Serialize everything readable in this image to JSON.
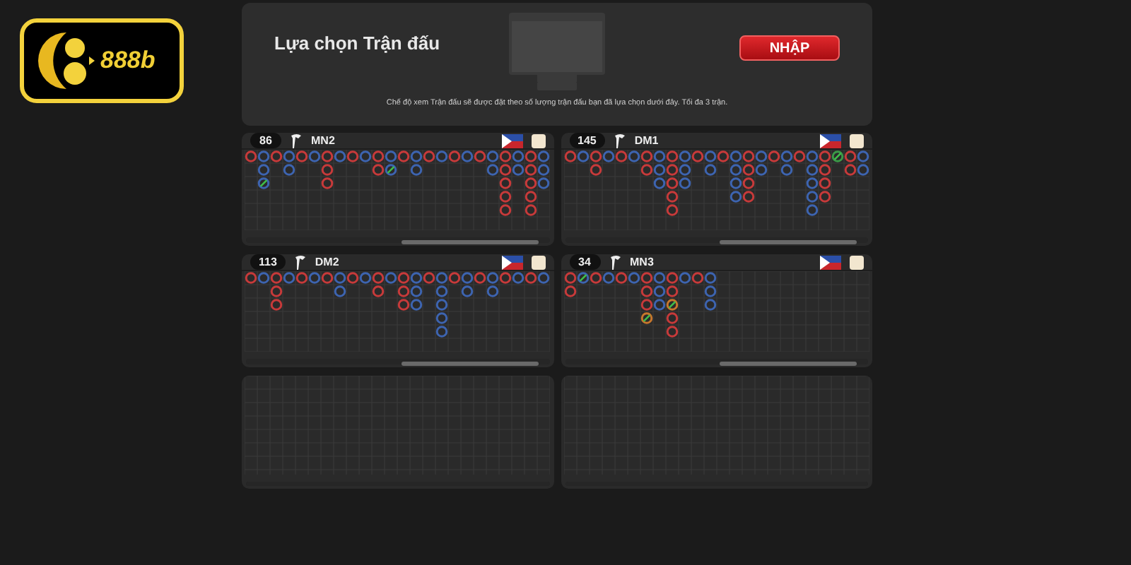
{
  "logo": {
    "text": "888b"
  },
  "header": {
    "title": "Lựa chọn Trận đấu",
    "button": "NHẬP",
    "note": "Chế độ xem Trận đấu sẽ được đặt theo số lượng trận đấu bạn đã lựa chọn dưới đây. Tối đa 3 trận."
  },
  "tables": [
    {
      "kind": "road",
      "count": "86",
      "name": "MN2",
      "selected": false,
      "columns": [
        [
          {
            "color": "#c73a3a",
            "tie": false
          }
        ],
        [
          {
            "color": "#3d64b0",
            "tie": false
          },
          {
            "color": "#3d64b0",
            "tie": false
          },
          {
            "color": "#3d64b0",
            "tie": true
          }
        ],
        [
          {
            "color": "#c73a3a",
            "tie": false
          }
        ],
        [
          {
            "color": "#3d64b0",
            "tie": false
          },
          {
            "color": "#3d64b0",
            "tie": false
          }
        ],
        [
          {
            "color": "#c73a3a",
            "tie": false
          }
        ],
        [
          {
            "color": "#3d64b0",
            "tie": false
          }
        ],
        [
          {
            "color": "#c73a3a",
            "tie": false
          },
          {
            "color": "#c73a3a",
            "tie": false
          },
          {
            "color": "#c73a3a",
            "tie": false
          }
        ],
        [
          {
            "color": "#3d64b0",
            "tie": false
          }
        ],
        [
          {
            "color": "#c73a3a",
            "tie": false
          }
        ],
        [
          {
            "color": "#3d64b0",
            "tie": false
          }
        ],
        [
          {
            "color": "#c73a3a",
            "tie": false
          },
          {
            "color": "#c73a3a",
            "tie": false
          }
        ],
        [
          {
            "color": "#3d64b0",
            "tie": false
          },
          {
            "color": "#3d64b0",
            "tie": true
          }
        ],
        [
          {
            "color": "#c73a3a",
            "tie": false
          }
        ],
        [
          {
            "color": "#3d64b0",
            "tie": false
          },
          {
            "color": "#3d64b0",
            "tie": false
          }
        ],
        [
          {
            "color": "#c73a3a",
            "tie": false
          }
        ],
        [
          {
            "color": "#3d64b0",
            "tie": false
          }
        ],
        [
          {
            "color": "#c73a3a",
            "tie": false
          }
        ],
        [
          {
            "color": "#3d64b0",
            "tie": false
          }
        ],
        [
          {
            "color": "#c73a3a",
            "tie": false
          }
        ],
        [
          {
            "color": "#3d64b0",
            "tie": false
          },
          {
            "color": "#3d64b0",
            "tie": false
          }
        ],
        [
          {
            "color": "#c73a3a",
            "tie": false
          },
          {
            "color": "#c73a3a",
            "tie": false
          },
          {
            "color": "#c73a3a",
            "tie": false
          },
          {
            "color": "#c73a3a",
            "tie": false
          },
          {
            "color": "#c73a3a",
            "tie": false
          }
        ],
        [
          {
            "color": "#3d64b0",
            "tie": false
          },
          {
            "color": "#3d64b0",
            "tie": false
          }
        ],
        [
          {
            "color": "#c73a3a",
            "tie": false
          },
          {
            "color": "#c73a3a",
            "tie": false
          },
          {
            "color": "#c73a3a",
            "tie": false
          },
          {
            "color": "#c73a3a",
            "tie": false
          },
          {
            "color": "#c73a3a",
            "tie": false
          }
        ],
        [
          {
            "color": "#3d64b0",
            "tie": false
          },
          {
            "color": "#3d64b0",
            "tie": false
          },
          {
            "color": "#3d64b0",
            "tie": false
          }
        ]
      ]
    },
    {
      "kind": "road",
      "count": "145",
      "name": "DM1",
      "selected": false,
      "columns": [
        [
          {
            "color": "#c73a3a",
            "tie": false
          }
        ],
        [
          {
            "color": "#3d64b0",
            "tie": false
          }
        ],
        [
          {
            "color": "#c73a3a",
            "tie": false
          },
          {
            "color": "#c73a3a",
            "tie": false
          }
        ],
        [
          {
            "color": "#3d64b0",
            "tie": false
          }
        ],
        [
          {
            "color": "#c73a3a",
            "tie": false
          }
        ],
        [
          {
            "color": "#3d64b0",
            "tie": false
          }
        ],
        [
          {
            "color": "#c73a3a",
            "tie": false
          },
          {
            "color": "#c73a3a",
            "tie": false
          }
        ],
        [
          {
            "color": "#3d64b0",
            "tie": false
          },
          {
            "color": "#3d64b0",
            "tie": false
          },
          {
            "color": "#3d64b0",
            "tie": false
          }
        ],
        [
          {
            "color": "#c73a3a",
            "tie": false
          },
          {
            "color": "#c73a3a",
            "tie": false
          },
          {
            "color": "#c73a3a",
            "tie": false
          },
          {
            "color": "#c73a3a",
            "tie": false
          },
          {
            "color": "#c73a3a",
            "tie": false
          }
        ],
        [
          {
            "color": "#3d64b0",
            "tie": false
          },
          {
            "color": "#3d64b0",
            "tie": false
          },
          {
            "color": "#3d64b0",
            "tie": false
          }
        ],
        [
          {
            "color": "#c73a3a",
            "tie": false
          }
        ],
        [
          {
            "color": "#3d64b0",
            "tie": false
          },
          {
            "color": "#3d64b0",
            "tie": false
          }
        ],
        [
          {
            "color": "#c73a3a",
            "tie": false
          }
        ],
        [
          {
            "color": "#3d64b0",
            "tie": false
          },
          {
            "color": "#3d64b0",
            "tie": false
          },
          {
            "color": "#3d64b0",
            "tie": false
          },
          {
            "color": "#3d64b0",
            "tie": false
          }
        ],
        [
          {
            "color": "#c73a3a",
            "tie": false
          },
          {
            "color": "#c73a3a",
            "tie": false
          },
          {
            "color": "#c73a3a",
            "tie": false
          },
          {
            "color": "#c73a3a",
            "tie": false
          }
        ],
        [
          {
            "color": "#3d64b0",
            "tie": false
          },
          {
            "color": "#3d64b0",
            "tie": false
          }
        ],
        [
          {
            "color": "#c73a3a",
            "tie": false
          }
        ],
        [
          {
            "color": "#3d64b0",
            "tie": false
          },
          {
            "color": "#3d64b0",
            "tie": false
          }
        ],
        [
          {
            "color": "#c73a3a",
            "tie": false
          }
        ],
        [
          {
            "color": "#3d64b0",
            "tie": false
          },
          {
            "color": "#3d64b0",
            "tie": false
          },
          {
            "color": "#3d64b0",
            "tie": false
          },
          {
            "color": "#3d64b0",
            "tie": false
          },
          {
            "color": "#3d64b0",
            "tie": false
          }
        ],
        [
          {
            "color": "#c73a3a",
            "tie": false
          },
          {
            "color": "#c73a3a",
            "tie": false
          },
          {
            "color": "#c73a3a",
            "tie": false
          },
          {
            "color": "#c73a3a",
            "tie": false
          }
        ],
        [
          {
            "color": "#3b9a48",
            "tie": true
          }
        ],
        [
          {
            "color": "#c73a3a",
            "tie": false
          },
          {
            "color": "#c73a3a",
            "tie": false
          }
        ],
        [
          {
            "color": "#3d64b0",
            "tie": false
          },
          {
            "color": "#3d64b0",
            "tie": false
          }
        ]
      ]
    },
    {
      "kind": "road",
      "count": "113",
      "name": "DM2",
      "selected": false,
      "columns": [
        [
          {
            "color": "#c73a3a",
            "tie": false
          }
        ],
        [
          {
            "color": "#3d64b0",
            "tie": false
          }
        ],
        [
          {
            "color": "#c73a3a",
            "tie": false
          },
          {
            "color": "#c73a3a",
            "tie": false
          },
          {
            "color": "#c73a3a",
            "tie": false
          }
        ],
        [
          {
            "color": "#3d64b0",
            "tie": false
          }
        ],
        [
          {
            "color": "#c73a3a",
            "tie": false
          }
        ],
        [
          {
            "color": "#3d64b0",
            "tie": false
          }
        ],
        [
          {
            "color": "#c73a3a",
            "tie": false
          }
        ],
        [
          {
            "color": "#3d64b0",
            "tie": false
          },
          {
            "color": "#3d64b0",
            "tie": false
          }
        ],
        [
          {
            "color": "#c73a3a",
            "tie": false
          }
        ],
        [
          {
            "color": "#3d64b0",
            "tie": false
          }
        ],
        [
          {
            "color": "#c73a3a",
            "tie": false
          },
          {
            "color": "#c73a3a",
            "tie": false
          }
        ],
        [
          {
            "color": "#3d64b0",
            "tie": false
          }
        ],
        [
          {
            "color": "#c73a3a",
            "tie": false
          },
          {
            "color": "#c73a3a",
            "tie": false
          },
          {
            "color": "#c73a3a",
            "tie": false
          }
        ],
        [
          {
            "color": "#3d64b0",
            "tie": false
          },
          {
            "color": "#3d64b0",
            "tie": false
          },
          {
            "color": "#3d64b0",
            "tie": false
          }
        ],
        [
          {
            "color": "#c73a3a",
            "tie": false
          }
        ],
        [
          {
            "color": "#3d64b0",
            "tie": false
          },
          {
            "color": "#3d64b0",
            "tie": false
          },
          {
            "color": "#3d64b0",
            "tie": false
          },
          {
            "color": "#3d64b0",
            "tie": false
          },
          {
            "color": "#3d64b0",
            "tie": false
          }
        ],
        [
          {
            "color": "#c73a3a",
            "tie": false
          }
        ],
        [
          {
            "color": "#3d64b0",
            "tie": false
          },
          {
            "color": "#3d64b0",
            "tie": false
          }
        ],
        [
          {
            "color": "#c73a3a",
            "tie": false
          }
        ],
        [
          {
            "color": "#3d64b0",
            "tie": false
          },
          {
            "color": "#3d64b0",
            "tie": false
          }
        ],
        [
          {
            "color": "#c73a3a",
            "tie": false
          }
        ],
        [
          {
            "color": "#3d64b0",
            "tie": false
          }
        ],
        [
          {
            "color": "#c73a3a",
            "tie": false
          }
        ],
        [
          {
            "color": "#3d64b0",
            "tie": false
          }
        ]
      ]
    },
    {
      "kind": "road",
      "count": "34",
      "name": "MN3",
      "selected": false,
      "columns": [
        [
          {
            "color": "#c73a3a",
            "tie": false
          },
          {
            "color": "#c73a3a",
            "tie": false
          }
        ],
        [
          {
            "color": "#3d64b0",
            "tie": true
          }
        ],
        [
          {
            "color": "#c73a3a",
            "tie": false
          }
        ],
        [
          {
            "color": "#3d64b0",
            "tie": false
          }
        ],
        [
          {
            "color": "#c73a3a",
            "tie": false
          }
        ],
        [
          {
            "color": "#3d64b0",
            "tie": false
          }
        ],
        [
          {
            "color": "#c73a3a",
            "tie": false
          },
          {
            "color": "#c73a3a",
            "tie": false
          },
          {
            "color": "#c73a3a",
            "tie": false
          },
          {
            "color": "#c7772c",
            "tie": true
          }
        ],
        [
          {
            "color": "#3d64b0",
            "tie": false
          },
          {
            "color": "#3d64b0",
            "tie": false
          },
          {
            "color": "#3d64b0",
            "tie": false
          }
        ],
        [
          {
            "color": "#c73a3a",
            "tie": false
          },
          {
            "color": "#c73a3a",
            "tie": false
          },
          {
            "color": "#c7772c",
            "tie": true
          },
          {
            "color": "#c73a3a",
            "tie": false
          },
          {
            "color": "#c73a3a",
            "tie": false
          }
        ],
        [
          {
            "color": "#3d64b0",
            "tie": false
          }
        ],
        [
          {
            "color": "#c73a3a",
            "tie": false
          }
        ],
        [
          {
            "color": "#3d64b0",
            "tie": false
          },
          {
            "color": "#3d64b0",
            "tie": false
          },
          {
            "color": "#3d64b0",
            "tie": false
          }
        ]
      ]
    },
    {
      "kind": "empty"
    },
    {
      "kind": "empty"
    }
  ]
}
